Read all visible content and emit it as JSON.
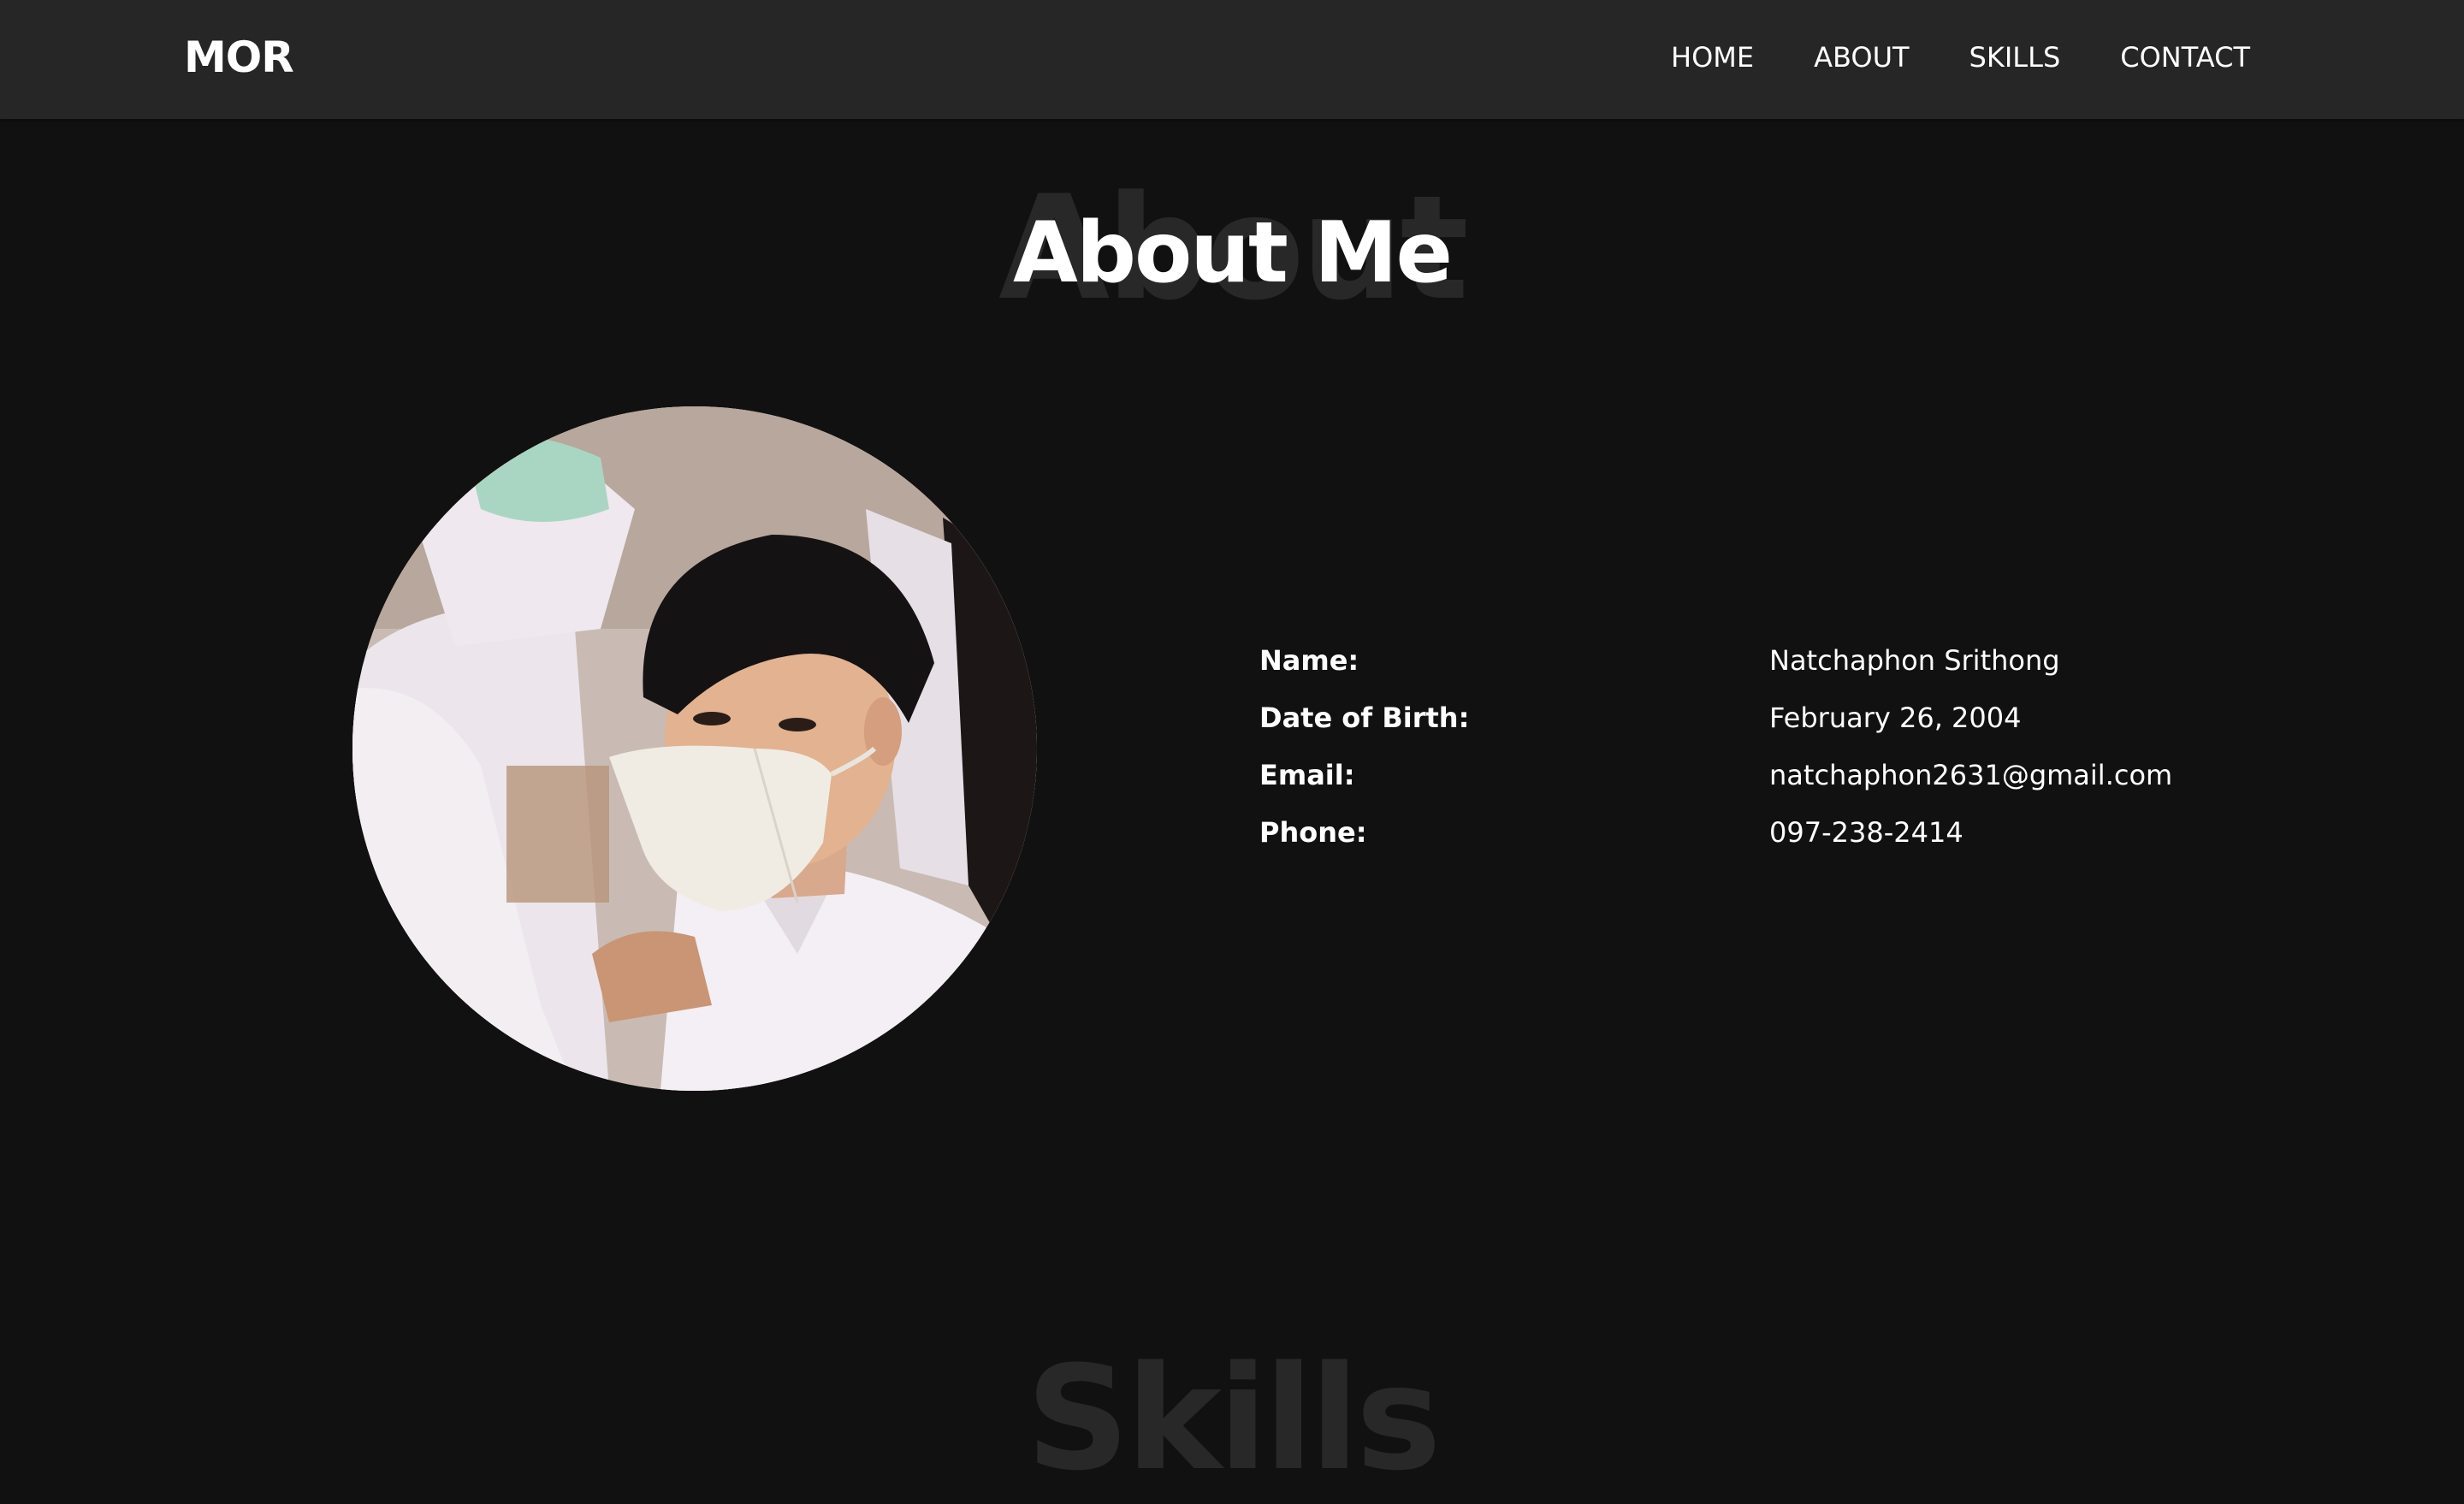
{
  "header": {
    "logo": "MOR",
    "nav": [
      {
        "label": "HOME"
      },
      {
        "label": "ABOUT"
      },
      {
        "label": "SKILLS"
      },
      {
        "label": "CONTACT"
      }
    ]
  },
  "about": {
    "ghost_title": "About",
    "title": "About Me",
    "photo_icon": "profile-photo",
    "info": [
      {
        "label": "Name:",
        "value": "Natchaphon Srithong"
      },
      {
        "label": "Date of Birth:",
        "value": "February 26, 2004"
      },
      {
        "label": "Email:",
        "value": "natchaphon2631@gmail.com"
      },
      {
        "label": "Phone:",
        "value": "097-238-2414"
      }
    ]
  },
  "skills": {
    "ghost_title": "Skills"
  },
  "colors": {
    "background": "#111111",
    "navbar": "#262626",
    "ghost_text": "#282828",
    "text": "#ffffff"
  }
}
